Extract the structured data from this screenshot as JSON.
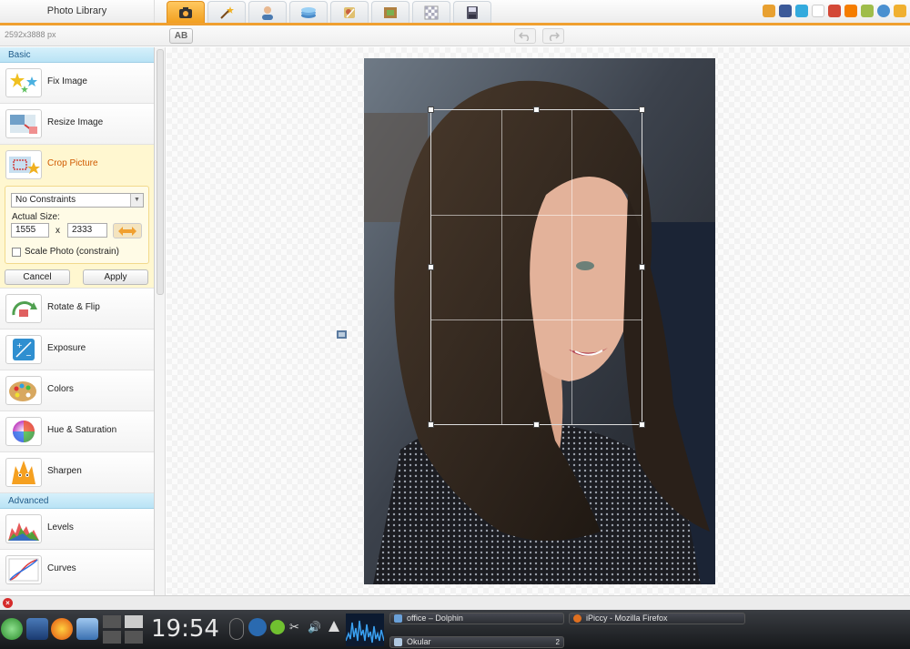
{
  "app": {
    "title": "Photo Library",
    "image_dimensions": "2592x3888 px",
    "compare_label": "AB"
  },
  "toolbar": {
    "tabs": [
      {
        "name": "camera-icon",
        "active": true
      },
      {
        "name": "magic-wand-icon",
        "active": false
      },
      {
        "name": "portrait-icon",
        "active": false
      },
      {
        "name": "layers-icon",
        "active": false
      },
      {
        "name": "stickers-icon",
        "active": false
      },
      {
        "name": "frame-icon",
        "active": false
      },
      {
        "name": "texture-icon",
        "active": false
      },
      {
        "name": "save-icon",
        "active": false
      }
    ],
    "social_icons": [
      "home-icon",
      "facebook-icon",
      "twitter-icon",
      "flickr-icon",
      "google-plus-icon",
      "blogger-icon",
      "picasa-icon",
      "web-icon",
      "email-icon",
      "close-icon"
    ]
  },
  "sidebar": {
    "sections": {
      "basic": "Basic",
      "advanced": "Advanced"
    },
    "basic_items": [
      {
        "label": "Fix Image",
        "icon": "fix-image-icon"
      },
      {
        "label": "Resize Image",
        "icon": "resize-image-icon"
      },
      {
        "label": "Crop Picture",
        "icon": "crop-picture-icon",
        "active": true
      },
      {
        "label": "Rotate & Flip",
        "icon": "rotate-flip-icon"
      },
      {
        "label": "Exposure",
        "icon": "exposure-icon"
      },
      {
        "label": "Colors",
        "icon": "colors-icon"
      },
      {
        "label": "Hue & Saturation",
        "icon": "hue-saturation-icon"
      },
      {
        "label": "Sharpen",
        "icon": "sharpen-icon"
      }
    ],
    "advanced_items": [
      {
        "label": "Levels",
        "icon": "levels-icon"
      },
      {
        "label": "Curves",
        "icon": "curves-icon"
      }
    ]
  },
  "crop": {
    "constraint": "No Constraints",
    "actual_size_label": "Actual Size:",
    "width": "1555",
    "separator": "x",
    "height": "2333",
    "scale_label": "Scale Photo (constrain)",
    "scale_checked": false,
    "cancel": "Cancel",
    "apply": "Apply"
  },
  "taskbar": {
    "clock": "19:54",
    "tasks": [
      {
        "label": "office – Dolphin"
      },
      {
        "label": "iPiccy - Mozilla Firefox"
      },
      {
        "label": "Okular"
      }
    ],
    "desktop_counter": "2"
  },
  "colors": {
    "accent": "#f2a020",
    "section_header": "#b9e3f5",
    "active_item": "#fff7d0"
  }
}
